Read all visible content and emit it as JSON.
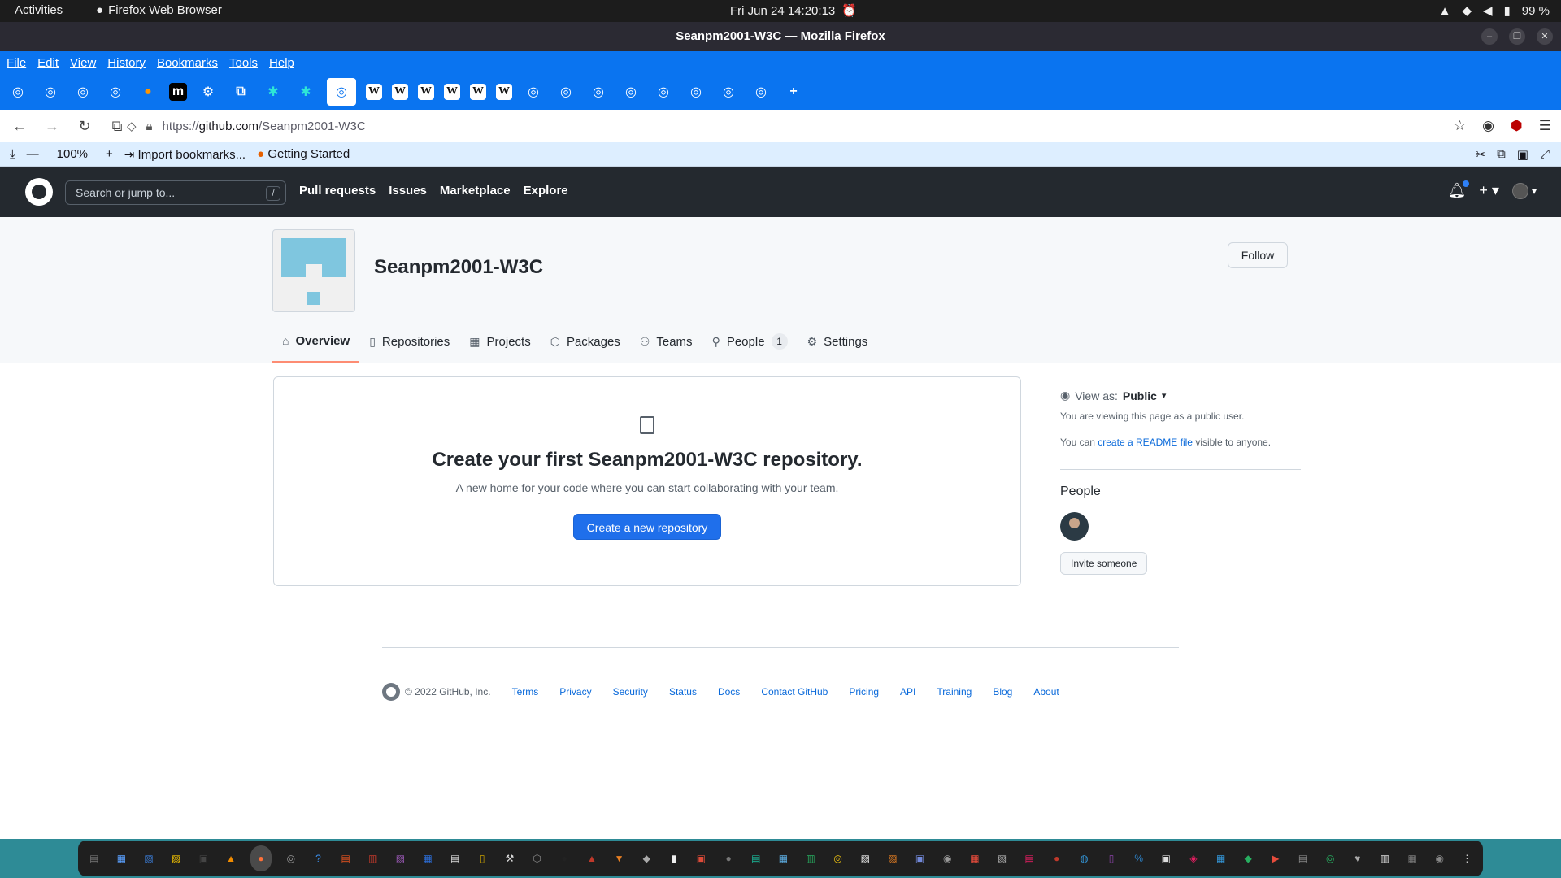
{
  "system": {
    "activities": "Activities",
    "app_name": "Firefox Web Browser",
    "clock": "Fri Jun 24  14:20:13",
    "battery": "99 %"
  },
  "window": {
    "title": "Seanpm2001-W3C — Mozilla Firefox"
  },
  "menubar": [
    "File",
    "Edit",
    "View",
    "History",
    "Bookmarks",
    "Tools",
    "Help"
  ],
  "tabs": [
    {
      "icon": "github-icon"
    },
    {
      "icon": "github-icon"
    },
    {
      "icon": "github-icon"
    },
    {
      "icon": "github-icon"
    },
    {
      "icon": "firefox-icon"
    },
    {
      "icon": "medium-icon"
    },
    {
      "icon": "gear-icon"
    },
    {
      "icon": "puzzle-icon"
    },
    {
      "icon": "gitlab-icon"
    },
    {
      "icon": "gitlab-icon"
    },
    {
      "icon": "github-icon",
      "active": true
    },
    {
      "icon": "wikipedia-icon"
    },
    {
      "icon": "wikipedia-icon"
    },
    {
      "icon": "wikipedia-icon"
    },
    {
      "icon": "wikipedia-icon"
    },
    {
      "icon": "wikipedia-icon"
    },
    {
      "icon": "wikipedia-icon"
    },
    {
      "icon": "github-icon"
    },
    {
      "icon": "github-icon"
    },
    {
      "icon": "github-icon"
    },
    {
      "icon": "github-icon"
    },
    {
      "icon": "github-icon"
    },
    {
      "icon": "github-icon"
    },
    {
      "icon": "github-icon"
    },
    {
      "icon": "github-icon"
    }
  ],
  "url": {
    "scheme": "https://",
    "host": "github.com",
    "path": "/Seanpm2001-W3C"
  },
  "bookmarks": {
    "zoom": "100%",
    "import": "Import bookmarks...",
    "getting_started": "Getting Started"
  },
  "github": {
    "search_placeholder": "Search or jump to...",
    "search_shortcut": "/",
    "nav": [
      "Pull requests",
      "Issues",
      "Marketplace",
      "Explore"
    ]
  },
  "org": {
    "name": "Seanpm2001-W3C",
    "follow_label": "Follow",
    "tabs": [
      {
        "label": "Overview",
        "icon": "home-icon",
        "selected": true
      },
      {
        "label": "Repositories",
        "icon": "repo-icon"
      },
      {
        "label": "Projects",
        "icon": "table-icon"
      },
      {
        "label": "Packages",
        "icon": "package-icon"
      },
      {
        "label": "Teams",
        "icon": "people-icon"
      },
      {
        "label": "People",
        "icon": "person-icon",
        "count": "1"
      },
      {
        "label": "Settings",
        "icon": "gear-icon"
      }
    ]
  },
  "blankslate": {
    "title": "Create your first Seanpm2001-W3C repository.",
    "description": "A new home for your code where you can start collaborating with your team.",
    "button": "Create a new repository"
  },
  "sidebar": {
    "view_as_label": "View as:",
    "view_as_value": "Public",
    "viewing_note": "You are viewing this page as a public user.",
    "readme_prefix": "You can ",
    "readme_link": "create a README file",
    "readme_suffix": " visible to anyone.",
    "people_heading": "People",
    "invite_label": "Invite someone"
  },
  "footer": {
    "copyright": "© 2022 GitHub, Inc.",
    "links": [
      "Terms",
      "Privacy",
      "Security",
      "Status",
      "Docs",
      "Contact GitHub",
      "Pricing",
      "API",
      "Training",
      "Blog",
      "About"
    ]
  },
  "colors": {
    "firefox_accent": "#0a74f0",
    "github_header": "#24292f",
    "primary_button": "#1f6feb",
    "selected_tab_underline": "#fd8c73",
    "link": "#0969da"
  }
}
